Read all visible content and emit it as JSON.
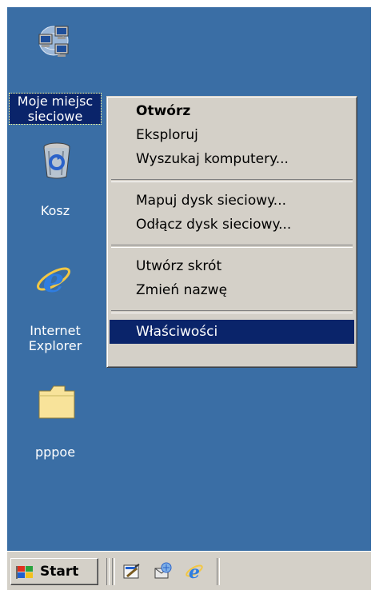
{
  "desktop": {
    "background_color": "#3a6ea5",
    "icons": [
      {
        "name": "my-network-places",
        "label": "Moje miejsc\nsieciowe",
        "icon": "network-places-icon",
        "selected": true
      },
      {
        "name": "recycle-bin",
        "label": "Kosz",
        "icon": "recycle-bin-icon",
        "selected": false
      },
      {
        "name": "internet-explorer",
        "label": "Internet\nExplorer",
        "icon": "internet-explorer-icon",
        "selected": false
      },
      {
        "name": "pppoe-folder",
        "label": "pppoe",
        "icon": "folder-icon",
        "selected": false
      }
    ]
  },
  "context_menu": {
    "items": [
      {
        "label": "Otwórz",
        "default": true
      },
      {
        "label": "Eksploruj"
      },
      {
        "label": "Wyszukaj komputery..."
      },
      {
        "label": "Mapuj dysk sieciowy..."
      },
      {
        "label": "Odłącz dysk sieciowy..."
      },
      {
        "label": "Utwórz skrót"
      },
      {
        "label": "Zmień nazwę"
      },
      {
        "label": "Właściwości",
        "highlighted": true
      }
    ],
    "highlight_color": "#0a246a"
  },
  "taskbar": {
    "start_label": "Start",
    "quick_launch": [
      "show-desktop-icon",
      "outlook-express-icon",
      "internet-explorer-icon"
    ]
  }
}
